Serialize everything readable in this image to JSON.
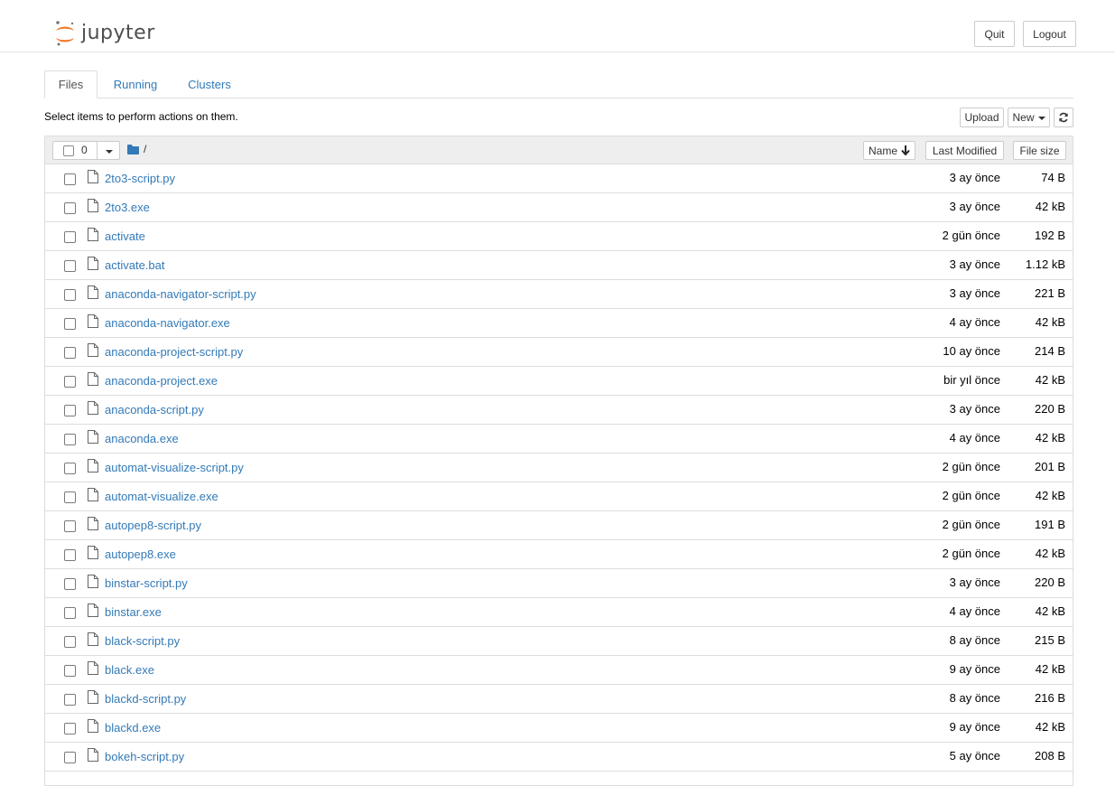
{
  "header": {
    "logo_text": "jupyter",
    "quit_label": "Quit",
    "logout_label": "Logout"
  },
  "tabs": [
    {
      "label": "Files",
      "active": true
    },
    {
      "label": "Running",
      "active": false
    },
    {
      "label": "Clusters",
      "active": false
    }
  ],
  "toolbar": {
    "instructions": "Select items to perform actions on them.",
    "upload_label": "Upload",
    "new_label": "New",
    "refresh_icon": "refresh-icon"
  },
  "list_header": {
    "selected_count": "0",
    "breadcrumb": "/",
    "sort_name_label": "Name",
    "sort_modified_label": "Last Modified",
    "sort_size_label": "File size"
  },
  "files": [
    {
      "name": "2to3-script.py",
      "modified": "3 ay önce",
      "size": "74 B"
    },
    {
      "name": "2to3.exe",
      "modified": "3 ay önce",
      "size": "42 kB"
    },
    {
      "name": "activate",
      "modified": "2 gün önce",
      "size": "192 B"
    },
    {
      "name": "activate.bat",
      "modified": "3 ay önce",
      "size": "1.12 kB"
    },
    {
      "name": "anaconda-navigator-script.py",
      "modified": "3 ay önce",
      "size": "221 B"
    },
    {
      "name": "anaconda-navigator.exe",
      "modified": "4 ay önce",
      "size": "42 kB"
    },
    {
      "name": "anaconda-project-script.py",
      "modified": "10 ay önce",
      "size": "214 B"
    },
    {
      "name": "anaconda-project.exe",
      "modified": "bir yıl önce",
      "size": "42 kB"
    },
    {
      "name": "anaconda-script.py",
      "modified": "3 ay önce",
      "size": "220 B"
    },
    {
      "name": "anaconda.exe",
      "modified": "4 ay önce",
      "size": "42 kB"
    },
    {
      "name": "automat-visualize-script.py",
      "modified": "2 gün önce",
      "size": "201 B"
    },
    {
      "name": "automat-visualize.exe",
      "modified": "2 gün önce",
      "size": "42 kB"
    },
    {
      "name": "autopep8-script.py",
      "modified": "2 gün önce",
      "size": "191 B"
    },
    {
      "name": "autopep8.exe",
      "modified": "2 gün önce",
      "size": "42 kB"
    },
    {
      "name": "binstar-script.py",
      "modified": "3 ay önce",
      "size": "220 B"
    },
    {
      "name": "binstar.exe",
      "modified": "4 ay önce",
      "size": "42 kB"
    },
    {
      "name": "black-script.py",
      "modified": "8 ay önce",
      "size": "215 B"
    },
    {
      "name": "black.exe",
      "modified": "9 ay önce",
      "size": "42 kB"
    },
    {
      "name": "blackd-script.py",
      "modified": "8 ay önce",
      "size": "216 B"
    },
    {
      "name": "blackd.exe",
      "modified": "9 ay önce",
      "size": "42 kB"
    },
    {
      "name": "bokeh-script.py",
      "modified": "5 ay önce",
      "size": "208 B"
    }
  ],
  "colors": {
    "link": "#337ab7",
    "logo_orange": "#f37726",
    "header_bg": "#eeeeee",
    "border": "#dddddd"
  }
}
